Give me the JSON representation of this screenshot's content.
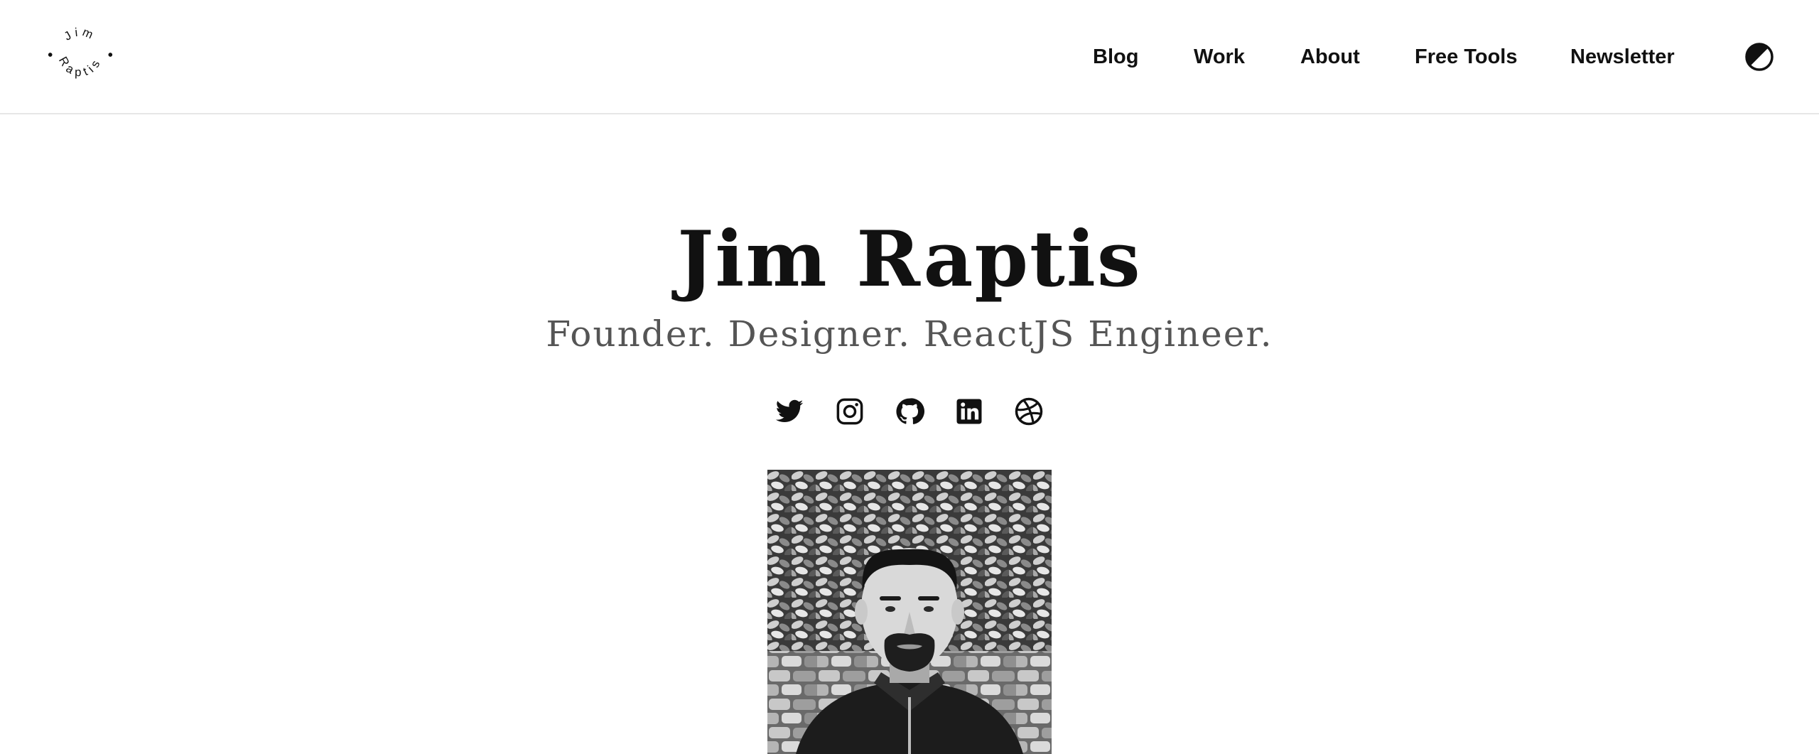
{
  "header": {
    "logo": {
      "text_top": "Jim",
      "text_bottom": "Raptis",
      "icon": "circular-text-logo"
    },
    "nav": [
      {
        "label": "Blog"
      },
      {
        "label": "Work"
      },
      {
        "label": "About"
      },
      {
        "label": "Free Tools"
      },
      {
        "label": "Newsletter"
      }
    ],
    "theme_toggle_icon": "half-moon-contrast-icon"
  },
  "hero": {
    "title": "Jim Raptis",
    "subtitle": "Founder. Designer. ReactJS Engineer."
  },
  "social_icons": [
    "twitter-icon",
    "instagram-icon",
    "github-icon",
    "linkedin-icon",
    "dribbble-icon"
  ],
  "photo": {
    "description_icon": "portrait-photo",
    "style": "black-and-white"
  },
  "colors": {
    "background": "#ffffff",
    "text": "#111111",
    "subtitle": "#555555",
    "divider": "#e6e6e6"
  }
}
